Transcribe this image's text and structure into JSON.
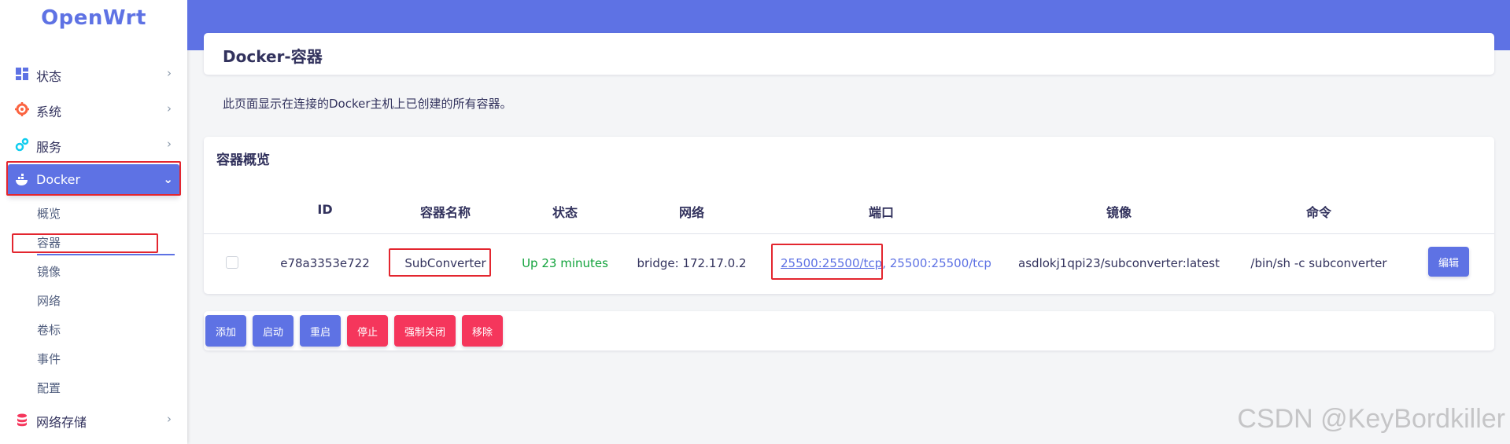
{
  "brand": "OpenWrt",
  "sidebar": {
    "items": [
      {
        "label": "状态",
        "icon": "dashboard-icon"
      },
      {
        "label": "系统",
        "icon": "gear-icon"
      },
      {
        "label": "服务",
        "icon": "services-icon"
      },
      {
        "label": "Docker",
        "icon": "docker-icon"
      },
      {
        "label": "网络存储",
        "icon": "storage-icon"
      }
    ],
    "docker_sub": [
      "概览",
      "容器",
      "镜像",
      "网络",
      "卷标",
      "事件",
      "配置"
    ],
    "chevron_right": "›",
    "chevron_down": "⌄"
  },
  "page": {
    "title": "Docker-容器",
    "description": "此页面显示在连接的Docker主机上已创建的所有容器。"
  },
  "containers": {
    "section_title": "容器概览",
    "headers": [
      "ID",
      "容器名称",
      "状态",
      "网络",
      "端口",
      "镜像",
      "命令"
    ],
    "rows": [
      {
        "id": "e78a3353e722",
        "name": "SubConverter",
        "status": "Up 23 minutes",
        "network": "bridge: 172.17.0.2",
        "port_link": "25500:25500/tcp",
        "port_sep": ",",
        "port_rest": " 25500:25500/tcp",
        "image": "asdlokj1qpi23/subconverter:latest",
        "command": "/bin/sh -c subconverter",
        "edit_label": "编辑"
      }
    ]
  },
  "actions": {
    "add": "添加",
    "start": "启动",
    "restart": "重启",
    "stop": "停止",
    "kill": "强制关闭",
    "remove": "移除"
  },
  "watermark": "CSDN @KeyBordkiller",
  "colors": {
    "accent": "#5e72e4",
    "danger": "#f5365c",
    "status_up": "#12a33c",
    "highlight_box": "#e3262f"
  }
}
